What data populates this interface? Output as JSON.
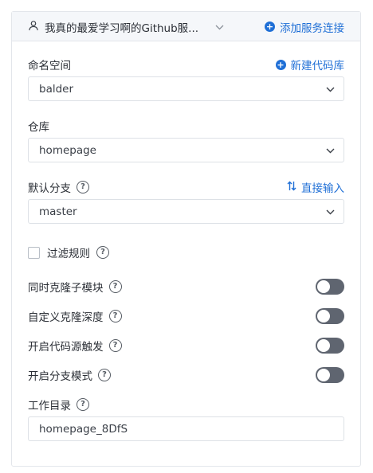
{
  "header": {
    "service_name": "我真的最爱学习啊的Github服...",
    "add_service_label": "添加服务连接"
  },
  "namespace": {
    "label": "命名空间",
    "new_repo_label": "新建代码库",
    "value": "balder"
  },
  "repo": {
    "label": "仓库",
    "value": "homepage"
  },
  "branch": {
    "label": "默认分支",
    "direct_input_label": "直接输入",
    "value": "master"
  },
  "filter": {
    "label": "过滤规则",
    "checked": false
  },
  "toggles": [
    {
      "label": "同时克隆子模块",
      "on": false
    },
    {
      "label": "自定义克隆深度",
      "on": false
    },
    {
      "label": "开启代码源触发",
      "on": false
    },
    {
      "label": "开启分支模式",
      "on": false
    }
  ],
  "workdir": {
    "label": "工作目录",
    "value": "homepage_8DfS"
  },
  "colors": {
    "accent": "#1f6fd6",
    "toggle_off": "#5f6570",
    "header_bg": "#f5f7fa"
  }
}
